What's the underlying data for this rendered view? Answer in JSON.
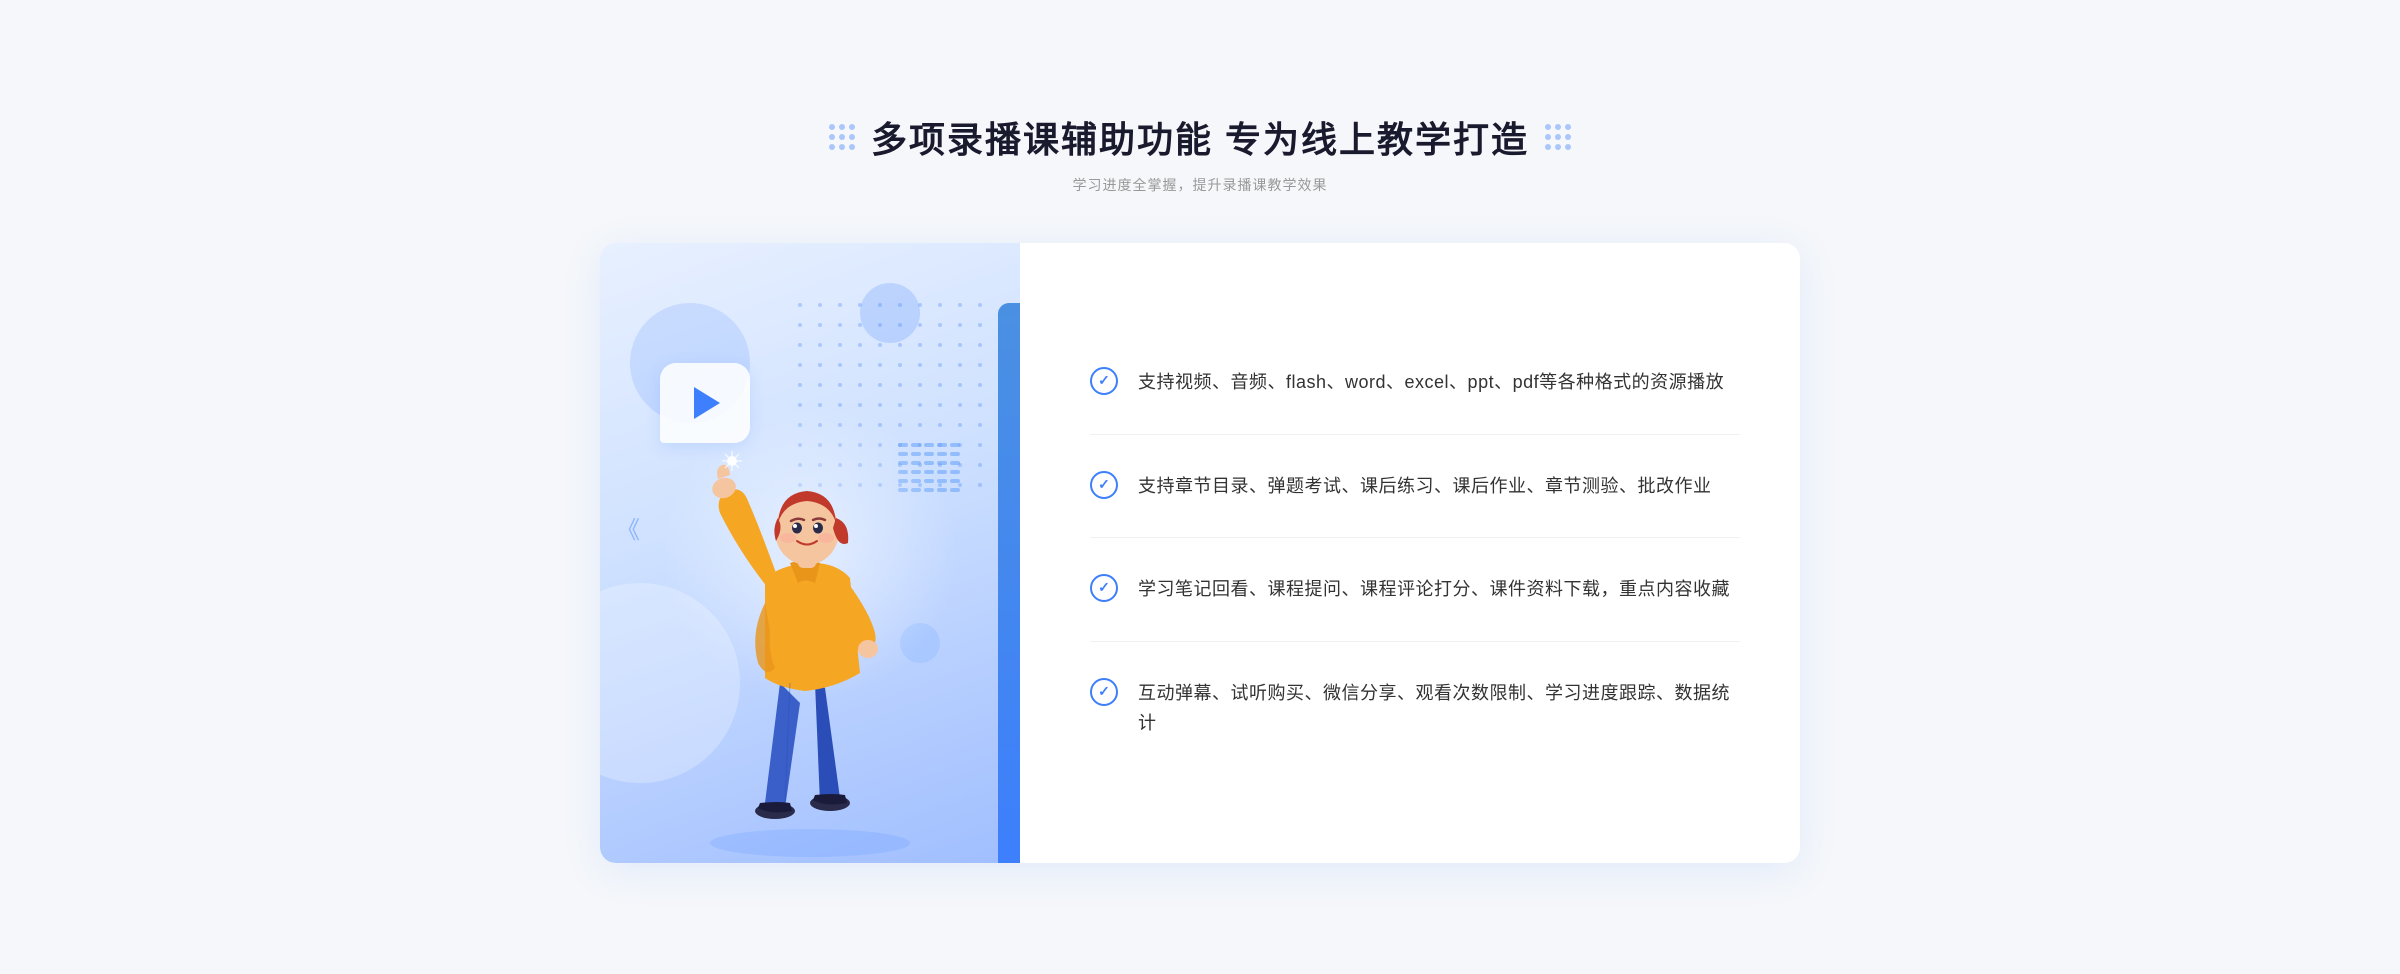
{
  "header": {
    "title": "多项录播课辅助功能 专为线上教学打造",
    "subtitle": "学习进度全掌握，提升录播课教学效果",
    "dots_left_label": "dots-left",
    "dots_right_label": "dots-right"
  },
  "features": [
    {
      "id": 1,
      "text": "支持视频、音频、flash、word、excel、ppt、pdf等各种格式的资源播放"
    },
    {
      "id": 2,
      "text": "支持章节目录、弹题考试、课后练习、课后作业、章节测验、批改作业"
    },
    {
      "id": 3,
      "text": "学习笔记回看、课程提问、课程评论打分、课件资料下载，重点内容收藏"
    },
    {
      "id": 4,
      "text": "互动弹幕、试听购买、微信分享、观看次数限制、学习进度跟踪、数据统计"
    }
  ],
  "colors": {
    "primary": "#3d7ffc",
    "title_dark": "#1a1a2e",
    "text_gray": "#333333",
    "subtitle_gray": "#999999"
  }
}
